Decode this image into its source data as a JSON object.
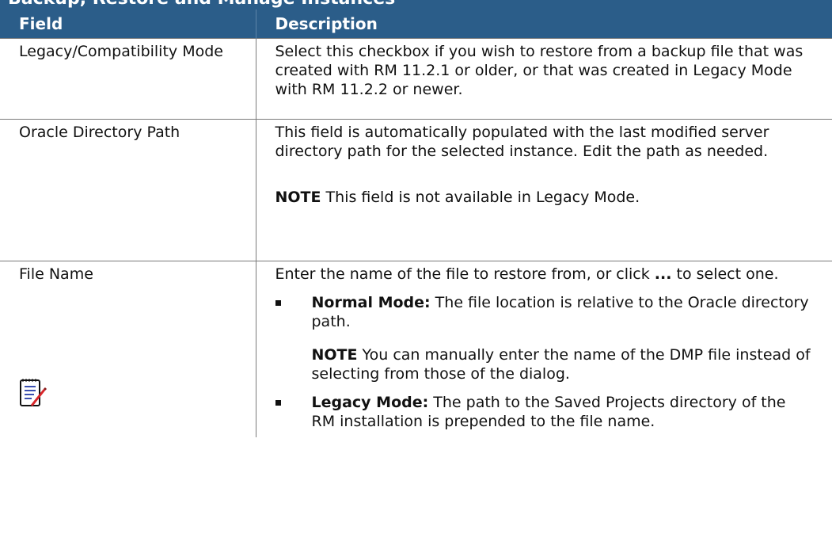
{
  "header_band": {
    "text": "Backup, Restore and Manage Instances"
  },
  "table": {
    "col1_header": "Field",
    "col2_header": "Description",
    "rows": [
      {
        "field": "Legacy/Compatibility Mode",
        "description": "Select this checkbox if you wish to restore from a backup file that was created with RM 11.2.1 or older, or that was created in Legacy Mode with RM 11.2.2 or newer."
      },
      {
        "field": "Oracle Directory Path",
        "description": "This field is automatically populated with the last modified server directory path for the selected instance. Edit the path as needed.",
        "note_label": "NOTE",
        "note_text": " This field is not available in Legacy Mode."
      },
      {
        "field": "File Name",
        "intro_before": "Enter the name of the file to restore from, or click ",
        "intro_bold": "...",
        "intro_after": " to select one.",
        "bullets": [
          {
            "label": "Normal Mode:",
            "text": " The file location is relative to the Oracle directory path.",
            "note_label": "NOTE",
            "note_text": " You can manually enter the name of the DMP file instead of selecting from those of the dialog."
          },
          {
            "label": "Legacy Mode:",
            "text": " The path to the Saved Projects directory of the RM installation is prepended to the file name."
          }
        ],
        "icon": "note-pad-icon"
      }
    ]
  },
  "colors": {
    "header_bg": "#2b5d89",
    "border": "#7a7a7a"
  }
}
